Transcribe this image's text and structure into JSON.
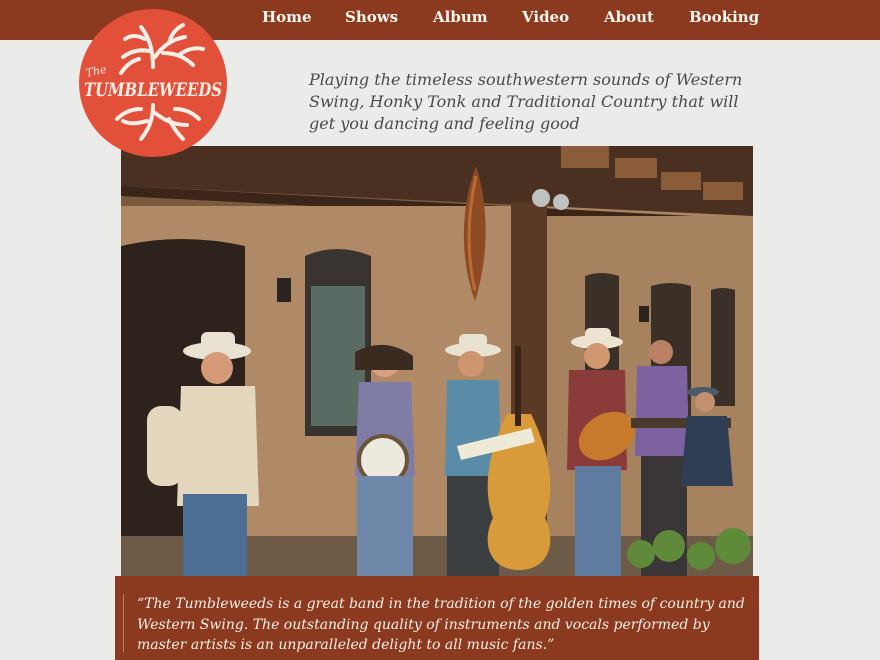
{
  "nav": {
    "items": [
      {
        "label": "Home"
      },
      {
        "label": "Shows"
      },
      {
        "label": "Album"
      },
      {
        "label": "Video"
      },
      {
        "label": "About"
      },
      {
        "label": "Booking"
      }
    ]
  },
  "logo": {
    "the_text": "The",
    "band_text": "TUMBLEWEEDS"
  },
  "tagline": "Playing the timeless southwestern sounds of Western Swing, Honky Tonk and Traditional Country that will get you dancing and feeling good",
  "quote": "“The Tumbleweeds is a great band in the tradition of the golden times of country and Western Swing. The outstanding quality of instruments and vocals performed by master artists is an unparalleled delight to all music fans.”",
  "colors": {
    "navbar": "#8c3a1f",
    "logo": "#e2503a",
    "background": "#ebebea"
  }
}
